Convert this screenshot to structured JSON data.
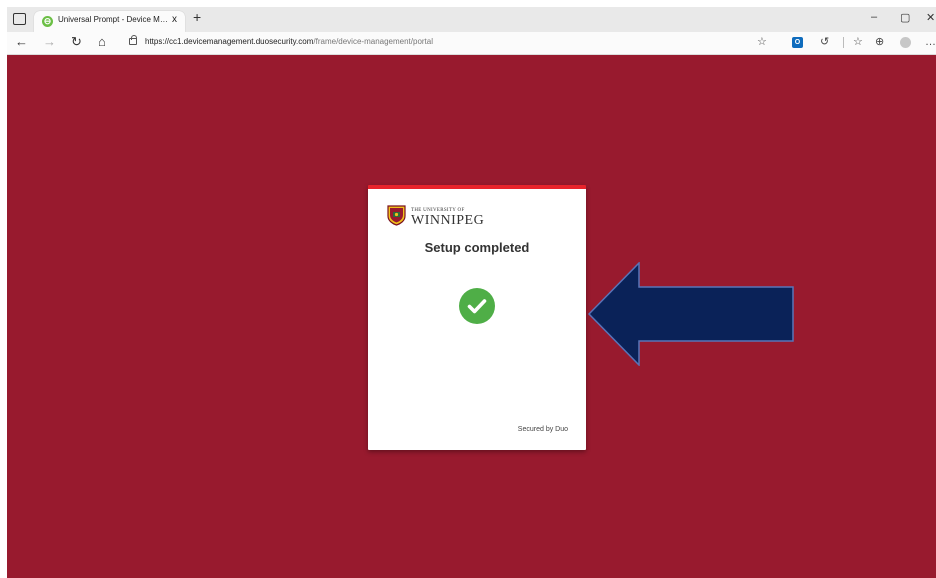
{
  "browser": {
    "tab_title": "Universal Prompt - Device Management",
    "tab_close": "x",
    "new_tab": "+",
    "url_host": "https://cc1.devicemanagement.duosecurity.com",
    "url_path": "/frame/device-management/portal",
    "window_controls": {
      "minimize": "–",
      "maximize": "▢",
      "close": "✕"
    },
    "icons": [
      "favorites-add-icon",
      "outlook-icon",
      "collections-icon",
      "favorites-icon",
      "tab-collections-icon",
      "profile-icon",
      "more-icon"
    ]
  },
  "page": {
    "background": "#981a2e",
    "card": {
      "logo_small": "THE UNIVERSITY OF",
      "logo_big": "WINNIPEG",
      "title": "Setup completed",
      "footer": "Secured by Duo",
      "accent": "#e8242c",
      "success_color": "#4fae47"
    },
    "arrow_color": "#0a2258"
  }
}
